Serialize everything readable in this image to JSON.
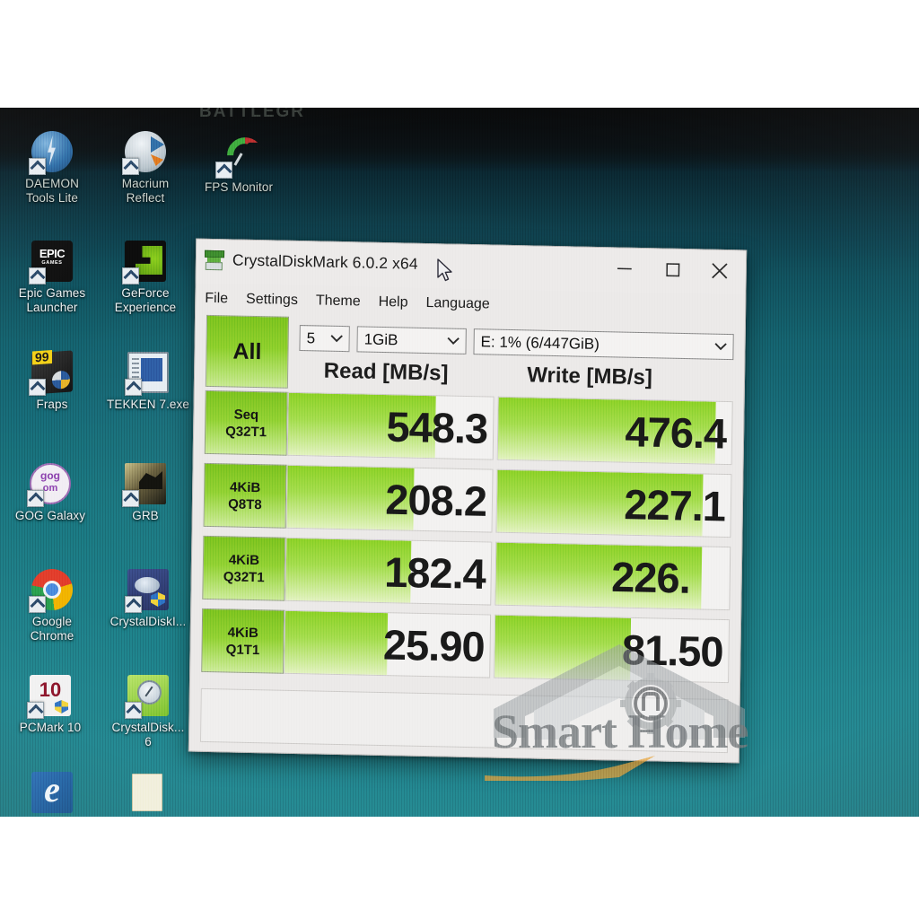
{
  "app": {
    "title": "CrystalDiskMark 6.0.2 x64",
    "icon": "disk-icon",
    "window_controls": {
      "minimize": "minimize-icon",
      "maximize": "maximize-icon",
      "close": "close-icon"
    }
  },
  "menu": {
    "items": [
      "File",
      "Settings",
      "Theme",
      "Help",
      "Language"
    ]
  },
  "toolbar": {
    "all_button": "All",
    "runs": {
      "value": "5",
      "arrow": "chevron-down-icon"
    },
    "test_size": {
      "value": "1GiB",
      "arrow": "chevron-down-icon"
    },
    "drive": {
      "value": "E: 1% (6/447GiB)",
      "arrow": "chevron-down-icon"
    }
  },
  "results": {
    "read_header": "Read [MB/s]",
    "write_header": "Write [MB/s]",
    "rows": [
      {
        "label_line1": "Seq",
        "label_line2": "Q32T1",
        "read": "548.3",
        "write": "476.4",
        "read_fill_pct": 72,
        "write_fill_pct": 93
      },
      {
        "label_line1": "4KiB",
        "label_line2": "Q8T8",
        "read": "208.2",
        "write": "227.1",
        "read_fill_pct": 62,
        "write_fill_pct": 88
      },
      {
        "label_line1": "4KiB",
        "label_line2": "Q32T1",
        "read": "182.4",
        "write": "226.",
        "read_fill_pct": 61,
        "write_fill_pct": 88
      },
      {
        "label_line1": "4KiB",
        "label_line2": "Q1T1",
        "read": "25.90",
        "write": "81.50",
        "read_fill_pct": 50,
        "write_fill_pct": 58
      }
    ]
  },
  "status_bar": {
    "text": ""
  },
  "desktop": {
    "wallpaper_text": "BATTLEGR",
    "icons": [
      {
        "name": "daemon-tools-lite",
        "label_line1": "DAEMON",
        "label_line2": "Tools Lite",
        "art": "ic-daemon",
        "dark": true
      },
      {
        "name": "macrium-reflect",
        "label_line1": "Macrium",
        "label_line2": "Reflect",
        "art": "ic-macrium",
        "dark": true
      },
      {
        "name": "fps-monitor",
        "label_line1": "FPS Monitor",
        "label_line2": "",
        "art": "ic-fps",
        "dark": true
      },
      {
        "name": "epic-games-launcher",
        "label_line1": "Epic Games",
        "label_line2": "Launcher",
        "art": "ic-epic",
        "dark": false
      },
      {
        "name": "geforce-experience",
        "label_line1": "GeForce",
        "label_line2": "Experience",
        "art": "ic-geforce",
        "dark": false
      },
      {
        "name": "fraps",
        "label_line1": "Fraps",
        "label_line2": "",
        "art": "ic-fraps",
        "dark": false
      },
      {
        "name": "tekken-7-exe",
        "label_line1": "TEKKEN 7.exe",
        "label_line2": "",
        "art": "ic-tekken",
        "dark": false
      },
      {
        "name": "gog-galaxy",
        "label_line1": "GOG Galaxy",
        "label_line2": "",
        "art": "ic-gog",
        "dark": false
      },
      {
        "name": "grb",
        "label_line1": "GRB",
        "label_line2": "",
        "art": "ic-grb",
        "dark": false
      },
      {
        "name": "google-chrome",
        "label_line1": "Google",
        "label_line2": "Chrome",
        "art": "ic-chrome",
        "dark": false
      },
      {
        "name": "crystaldiskinfo",
        "label_line1": "CrystalDiskI...",
        "label_line2": "",
        "art": "ic-cdi",
        "dark": false
      },
      {
        "name": "pcmark-10",
        "label_line1": "PCMark 10",
        "label_line2": "",
        "art": "ic-pcm",
        "dark": false
      },
      {
        "name": "crystaldiskmark-6",
        "label_line1": "CrystalDisk...",
        "label_line2": "6",
        "art": "ic-cdm",
        "dark": false
      }
    ]
  },
  "watermark": {
    "text": "Smart Home",
    "logo": "house-gear-icon"
  }
}
